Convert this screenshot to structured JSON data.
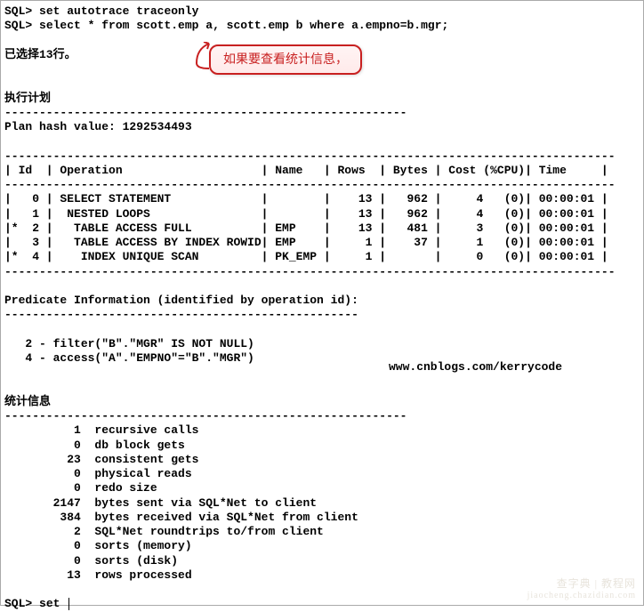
{
  "prompt": "SQL>",
  "commands": {
    "cmd1": "set autotrace traceonly",
    "cmd2": "select * from scott.emp a, scott.emp b where a.empno=b.mgr;",
    "cmd3": "set "
  },
  "messages": {
    "rows_selected": "已选择13行。"
  },
  "annotation": {
    "text": "如果要查看统计信息，"
  },
  "plan": {
    "title": "执行计划",
    "hash_line": "Plan hash value: 1292534493",
    "header": "| Id  | Operation                    | Name   | Rows  | Bytes | Cost (%CPU)| Time     |",
    "rows": [
      "|   0 | SELECT STATEMENT             |        |    13 |   962 |     4   (0)| 00:00:01 |",
      "|   1 |  NESTED LOOPS                |        |    13 |   962 |     4   (0)| 00:00:01 |",
      "|*  2 |   TABLE ACCESS FULL          | EMP    |    13 |   481 |     3   (0)| 00:00:01 |",
      "|   3 |   TABLE ACCESS BY INDEX ROWID| EMP    |     1 |    37 |     1   (0)| 00:00:01 |",
      "|*  4 |    INDEX UNIQUE SCAN         | PK_EMP |     1 |       |     0   (0)| 00:00:01 |"
    ]
  },
  "predicate": {
    "title": "Predicate Information (identified by operation id):",
    "lines": [
      "   2 - filter(\"B\".\"MGR\" IS NOT NULL)",
      "   4 - access(\"A\".\"EMPNO\"=\"B\".\"MGR\")"
    ]
  },
  "stats": {
    "title": "统计信息",
    "rows": [
      {
        "val": "1",
        "label": "recursive calls"
      },
      {
        "val": "0",
        "label": "db block gets"
      },
      {
        "val": "23",
        "label": "consistent gets"
      },
      {
        "val": "0",
        "label": "physical reads"
      },
      {
        "val": "0",
        "label": "redo size"
      },
      {
        "val": "2147",
        "label": "bytes sent via SQL*Net to client"
      },
      {
        "val": "384",
        "label": "bytes received via SQL*Net from client"
      },
      {
        "val": "2",
        "label": "SQL*Net roundtrips to/from client"
      },
      {
        "val": "0",
        "label": "sorts (memory)"
      },
      {
        "val": "0",
        "label": "sorts (disk)"
      },
      {
        "val": "13",
        "label": "rows processed"
      }
    ]
  },
  "urls": {
    "blog": "www.cnblogs.com/kerrycode",
    "watermark": "查字典 | 教程网",
    "watermark_sub": "jiaocheng.chazidian.com"
  },
  "hr": "----------------------------------------------------------------------------------------",
  "hr2": "----------------------------------------------------------",
  "hr3": "---------------------------------------------------"
}
